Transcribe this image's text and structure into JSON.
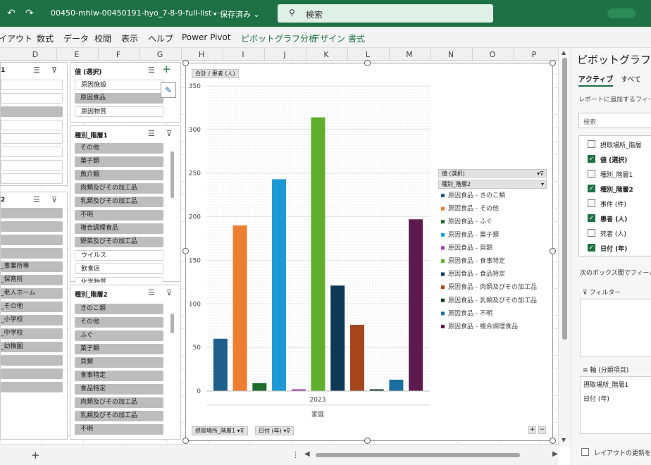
{
  "titlebar": {
    "filename": "00450-mhlw-00450191-hyo_7-8-9-full-list···",
    "save_state": "• 保存済み",
    "search_label": "検索"
  },
  "menu": [
    "イアウト",
    "数式",
    "データ",
    "校閲",
    "表示",
    "ヘルプ",
    "Power Pivot",
    "ピボットグラフ分析",
    "デザイン",
    "書式"
  ],
  "columns": [
    "D",
    "E",
    "F",
    "G",
    "H",
    "I",
    "J",
    "K",
    "L",
    "M",
    "N",
    "O",
    "P"
  ],
  "slicer_left": {
    "head1": "1",
    "head2": "2",
    "items2": [
      "_事業所等",
      "_保育所",
      "_老人ホーム",
      "_その他",
      "_小学校",
      "_中学校",
      "_幼稚園"
    ]
  },
  "slicer_value": {
    "title": "値 (選択)",
    "items": [
      {
        "label": "原因施設",
        "selected": false
      },
      {
        "label": "原因食品",
        "selected": true
      },
      {
        "label": "原因物質",
        "selected": false
      }
    ]
  },
  "slicer_kind1": {
    "title": "種別_階層1",
    "items": [
      "その他",
      "菓子類",
      "魚介類",
      "肉類及びその加工品",
      "乳類及びその加工品",
      "不明",
      "複合調理食品",
      "野菜及びその加工品",
      "ウイルス",
      "飲食店",
      "化学物質"
    ],
    "unselected": [
      8,
      9
    ]
  },
  "slicer_kind2": {
    "title": "種別_階層2",
    "items": [
      "きのこ類",
      "その他",
      "ふぐ",
      "菓子類",
      "貝類",
      "食事特定",
      "食品特定",
      "肉類及びその加工品",
      "乳類及びその加工品",
      "不明"
    ]
  },
  "chart_field_top": "合計 / 患者 (人)",
  "chart_field_bottom1": "摂取場所_階層1",
  "chart_field_bottom2": "日付 (年)",
  "legend_field1": "値 (選択)",
  "legend_field2": "種別_階層2",
  "chart_data": {
    "type": "bar",
    "categories": [
      "2023"
    ],
    "category_group": "家庭",
    "ylim": [
      0,
      350
    ],
    "yticks": [
      0,
      50,
      100,
      150,
      200,
      250,
      300,
      350
    ],
    "series": [
      {
        "name": "原因食品 - きのこ類",
        "value": 60,
        "color": "#1f5f8b"
      },
      {
        "name": "原因食品 - その他",
        "value": 190,
        "color": "#ed7d31"
      },
      {
        "name": "原因食品 - ふぐ",
        "value": 9,
        "color": "#1e6b2c"
      },
      {
        "name": "原因食品 - 菓子類",
        "value": 243,
        "color": "#1d9ad6"
      },
      {
        "name": "原因食品 - 貝類",
        "value": 2,
        "color": "#9b3fa8"
      },
      {
        "name": "原因食品 - 食事特定",
        "value": 314,
        "color": "#5fae2e"
      },
      {
        "name": "原因食品 - 食品特定",
        "value": 121,
        "color": "#0e3a56"
      },
      {
        "name": "原因食品 - 肉類及びその加工品",
        "value": 76,
        "color": "#a5461c"
      },
      {
        "name": "原因食品 - 乳類及びその加工品",
        "value": 2,
        "color": "#173f24"
      },
      {
        "name": "原因食品 - 不明",
        "value": 13,
        "color": "#1a6f9e"
      },
      {
        "name": "原因食品 - 複合調理食品",
        "value": 197,
        "color": "#5e1a4e"
      }
    ]
  },
  "pane": {
    "title": "ピボットグラフの",
    "tab_active": "アクティブ",
    "tab_all": "すべて",
    "desc": "レポートに追加するフィール",
    "search_placeholder": "検索",
    "fields": [
      {
        "label": "摂取場所_階層",
        "checked": false
      },
      {
        "label": "値 (選択)",
        "checked": true
      },
      {
        "label": "種別_階層1",
        "checked": false
      },
      {
        "label": "種別_階層2",
        "checked": true
      },
      {
        "label": "事件 (件)",
        "checked": false
      },
      {
        "label": "患者 (人)",
        "checked": true
      },
      {
        "label": "死者 (人)",
        "checked": false
      },
      {
        "label": "日付 (年)",
        "checked": true
      }
    ],
    "drag_hint": "次のボックス間でフィールド",
    "filter_label": "フィルター",
    "axis_label": "軸 (分類項目)",
    "axis_items": [
      "摂取場所_階層1",
      "日付 (年)"
    ],
    "defer_label": "レイアウトの更新を保"
  },
  "colors": {
    "accent": "#1e7145",
    "context_tab": "#1e7145"
  }
}
